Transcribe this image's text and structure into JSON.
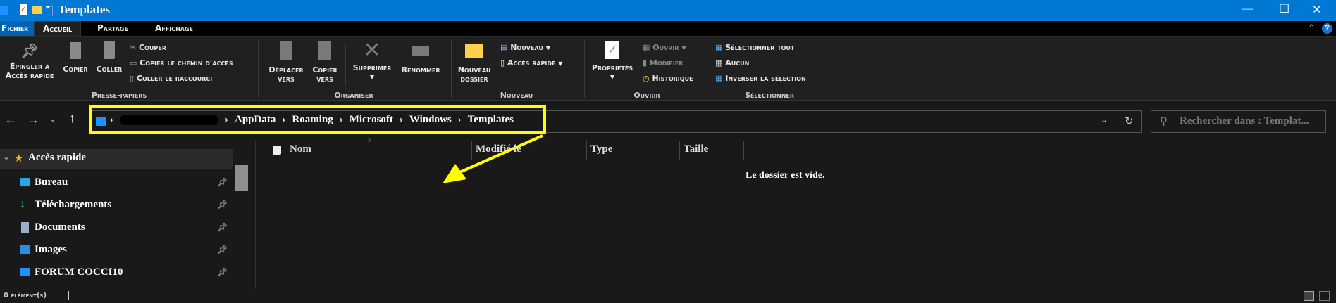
{
  "window": {
    "title": "Templates",
    "minimize": "—",
    "maximize": "☐",
    "close": "✕"
  },
  "tabs": [
    "Fichier",
    "Accueil",
    "Partage",
    "Affichage"
  ],
  "ribbon": {
    "pin": "Épingler à Accès rapide",
    "pin_l1": "Épingler à",
    "pin_l2": "Accès rapide",
    "copy": "Copier",
    "paste": "Coller",
    "cut": "Couper",
    "copy_path": "Copier le chemin d'accès",
    "paste_shortcut": "Coller le raccourci",
    "move_l1": "Déplacer",
    "move_l2": "vers",
    "copyto_l1": "Copier",
    "copyto_l2": "vers",
    "delete": "Supprimer",
    "rename": "Renommer",
    "newfolder_l1": "Nouveau",
    "newfolder_l2": "dossier",
    "new_item": "Nouveau",
    "easy_access": "Accès rapide",
    "properties": "Propriétés",
    "open": "Ouvrir",
    "edit": "Modifier",
    "history": "Historique",
    "select_all": "Sélectionner tout",
    "select_none": "Aucun",
    "invert": "Inverser la sélection",
    "groups": [
      "Presse-papiers",
      "Organiser",
      "Nouveau",
      "Ouvrir",
      "Sélectionner"
    ]
  },
  "address": {
    "crumbs": [
      "AppData",
      "Roaming",
      "Microsoft",
      "Windows",
      "Templates"
    ],
    "search_placeholder": "Rechercher dans : Templat..."
  },
  "nav": {
    "quick_access": "Accès rapide",
    "items": [
      {
        "label": "Bureau",
        "icon": "desktop-icon"
      },
      {
        "label": "Téléchargements",
        "icon": "download-icon"
      },
      {
        "label": "Documents",
        "icon": "documents-icon"
      },
      {
        "label": "Images",
        "icon": "images-icon"
      },
      {
        "label": "FORUM COCCI10",
        "icon": "folder-icon"
      }
    ]
  },
  "columns": [
    "Nom",
    "Modifié le",
    "Type",
    "Taille"
  ],
  "empty_message": "Le dossier est vide.",
  "status": "0 élément(s)",
  "colors": {
    "accent": "#0078d4",
    "highlight": "#ffff00"
  }
}
